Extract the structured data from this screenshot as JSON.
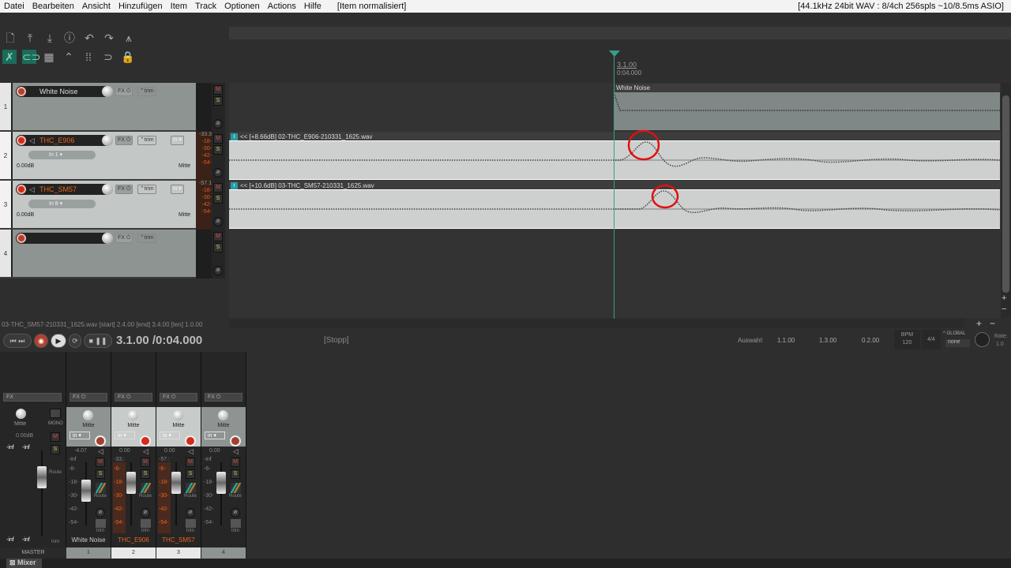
{
  "menu": {
    "items": [
      "Datei",
      "Bearbeiten",
      "Ansicht",
      "Hinzufügen",
      "Item",
      "Track",
      "Optionen",
      "Actions",
      "Hilfe"
    ],
    "status": "[Item normalisiert]",
    "audio": "[44.1kHz 24bit WAV : 8/4ch 256spls ~10/8.5ms ASIO]"
  },
  "toolbar": {
    "row1": [
      "new-project-icon",
      "save-icon",
      "load-icon",
      "info-icon",
      "undo-icon",
      "redo-icon",
      "metronome-icon"
    ],
    "row2": [
      "crossfade-icon",
      "link-icon",
      "grid-icon",
      "envelope-icon",
      "snap-icon",
      "loop-icon",
      "lock-icon"
    ]
  },
  "playhead": {
    "bar": "3.1.00",
    "time": "0:04.000"
  },
  "tracks": [
    {
      "num": "1",
      "name": "White Noise",
      "fx": "FX",
      "trim": "trim"
    },
    {
      "num": "2",
      "name": "THC_E906",
      "fx": "FX",
      "trim": "trim",
      "in": "in",
      "input": "In 1",
      "vol": "0.00dB",
      "pan": "Mitte",
      "peak": "-33.3",
      "meter": [
        "-18-",
        "-30-",
        "-42-",
        "-54-"
      ]
    },
    {
      "num": "3",
      "name": "THC_SM57",
      "fx": "FX",
      "trim": "trim",
      "in": "in",
      "input": "In 8",
      "vol": "0.00dB",
      "pan": "Mitte",
      "peak": "-57.1",
      "meter": [
        "-18-",
        "-30-",
        "-42-",
        "-54-"
      ]
    },
    {
      "num": "4",
      "name": "",
      "fx": "FX",
      "trim": "trim"
    }
  ],
  "ms": {
    "mute": "M",
    "solo": "S"
  },
  "items": {
    "white": "White Noise",
    "e906": "<< [+8.66dB] 02-THC_E906-210331_1625.wav",
    "sm57": "<< [+10.6dB] 03-THC_SM57-210331_1625.wav",
    "info": "i"
  },
  "statusline": "03-THC_SM57-210331_1625.wav [start] 2.4.00 [end] 3.4.00 [len] 1.0.00",
  "transport": {
    "position": "3.1.00 /0:04.000",
    "state": "[Stopp]",
    "selection_label": "Auswahl:",
    "sel_start": "1.1.00",
    "sel_end": "1.3.00",
    "sel_len": "0.2.00",
    "bpm_label": "BPM",
    "bpm": "120",
    "timesig": "4/4",
    "global_label": "GLOBAL",
    "global_value": "none",
    "rate_label": "Rate:",
    "rate": "1.0"
  },
  "mixer": {
    "master": {
      "name": "MASTER",
      "pan": "Mitte",
      "mono": "MONO",
      "vol": "0.00dB",
      "inf": "-inf",
      "route": "Route",
      "trim": "trim",
      "fx": "FX"
    },
    "strips": [
      {
        "num": "1",
        "name": "White Noise",
        "pan": "Mitte",
        "in": "in",
        "vol": "-4.07",
        "peak": "-inf",
        "fx": "FX",
        "route": "Route",
        "trim": "trim"
      },
      {
        "num": "2",
        "name": "THC_E906",
        "pan": "Mitte",
        "in": "in",
        "vol": "0.00",
        "peak": "-33.:",
        "fx": "FX",
        "route": "Route",
        "trim": "trim"
      },
      {
        "num": "3",
        "name": "THC_SM57",
        "pan": "Mitte",
        "in": "in",
        "vol": "0.00",
        "peak": "-57.:",
        "fx": "FX",
        "route": "Route",
        "trim": "trim"
      },
      {
        "num": "4",
        "name": "",
        "pan": "Mitte",
        "in": "in",
        "vol": "0.00",
        "peak": "-inf",
        "fx": "FX",
        "route": "Route",
        "trim": "trim"
      }
    ],
    "scale": [
      "-6-",
      "-18-",
      "-30-",
      "-42-",
      "-54-"
    ],
    "tab": "Mixer"
  },
  "colors": {
    "accent": "#3b9c8e",
    "selected_name": "#e8641e",
    "record": "#d42a1a",
    "annotation": "#e01010"
  }
}
